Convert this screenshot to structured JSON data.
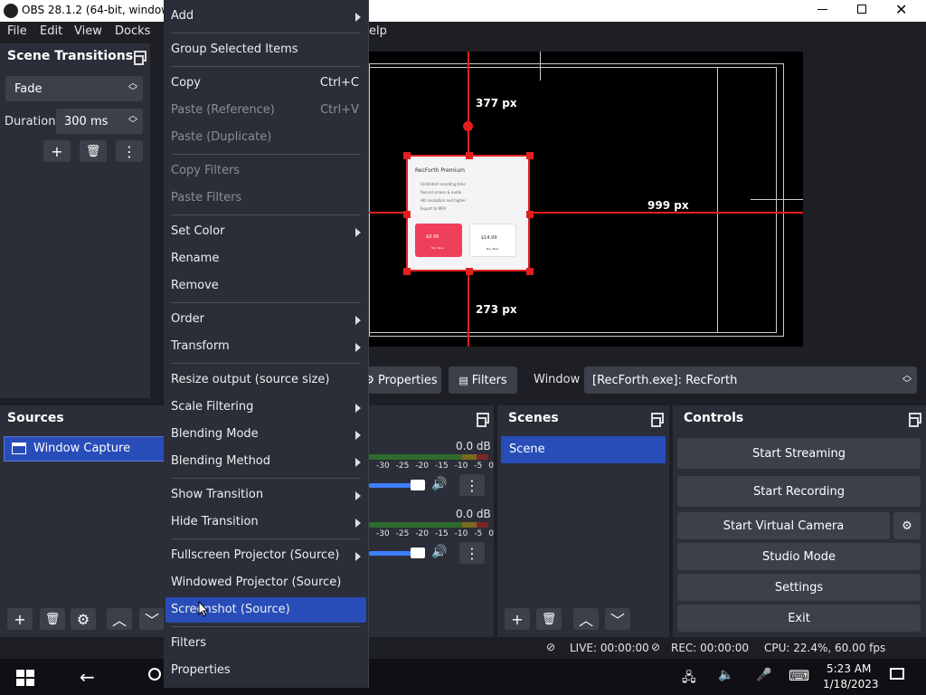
{
  "window": {
    "title": "OBS 28.1.2 (64-bit, windows) -"
  },
  "menubar": {
    "file": "File",
    "edit": "Edit",
    "view": "View",
    "docks": "Docks",
    "help_tail": "elp"
  },
  "transitions": {
    "title": "Scene Transitions",
    "selected": "Fade",
    "duration_label": "Duration",
    "duration_value": "300 ms"
  },
  "preview": {
    "label_top": "377 px",
    "label_right": "999 px",
    "label_bottom": "273 px",
    "thumbnail": {
      "brand": "RecForth Premium",
      "lines": [
        "Unlimited recording time",
        "Record screen & audio",
        "HD resolution and higher",
        "Export to MP4"
      ],
      "price_left": "$9.99",
      "price_right": "$14.99",
      "cta_left": "Buy Now",
      "cta_right": "Buy Now"
    }
  },
  "source_toolbar": {
    "properties": "Properties",
    "filters": "Filters",
    "window_label": "Window",
    "window_value": "[RecForth.exe]: RecForth"
  },
  "sources": {
    "title": "Sources",
    "items": [
      "Window Capture"
    ]
  },
  "mixer": {
    "channels": [
      {
        "db": "0.0 dB",
        "ticks": [
          "-30",
          "-25",
          "-20",
          "-15",
          "-10",
          "-5",
          "0"
        ]
      },
      {
        "db": "0.0 dB",
        "ticks": [
          "-30",
          "-25",
          "-20",
          "-15",
          "-10",
          "-5",
          "0"
        ]
      }
    ]
  },
  "scenes": {
    "title": "Scenes",
    "items": [
      "Scene"
    ]
  },
  "controls": {
    "title": "Controls",
    "start_streaming": "Start Streaming",
    "start_recording": "Start Recording",
    "start_virtual_camera": "Start Virtual Camera",
    "studio_mode": "Studio Mode",
    "settings": "Settings",
    "exit": "Exit"
  },
  "statusbar": {
    "live": "LIVE: 00:00:00",
    "rec": "REC: 00:00:00",
    "cpu": "CPU: 22.4%, 60.00 fps"
  },
  "context_menu": {
    "add": "Add",
    "group": "Group Selected Items",
    "copy": "Copy",
    "copy_sc": "Ctrl+C",
    "paste_ref": "Paste (Reference)",
    "paste_ref_sc": "Ctrl+V",
    "paste_dup": "Paste (Duplicate)",
    "copy_filters": "Copy Filters",
    "paste_filters": "Paste Filters",
    "set_color": "Set Color",
    "rename": "Rename",
    "remove": "Remove",
    "order": "Order",
    "transform": "Transform",
    "resize_output": "Resize output (source size)",
    "scale_filtering": "Scale Filtering",
    "blending_mode": "Blending Mode",
    "blending_method": "Blending Method",
    "show_transition": "Show Transition",
    "hide_transition": "Hide Transition",
    "fullscreen_projector": "Fullscreen Projector (Source)",
    "windowed_projector": "Windowed Projector (Source)",
    "screenshot": "Screenshot (Source)",
    "filters": "Filters",
    "properties": "Properties"
  },
  "taskbar": {
    "time": "5:23 AM",
    "date": "1/18/2023"
  },
  "colors": {
    "accent": "#284cb8",
    "panel": "#2b2e38",
    "button": "#3c404b",
    "guide": "#e02020"
  }
}
